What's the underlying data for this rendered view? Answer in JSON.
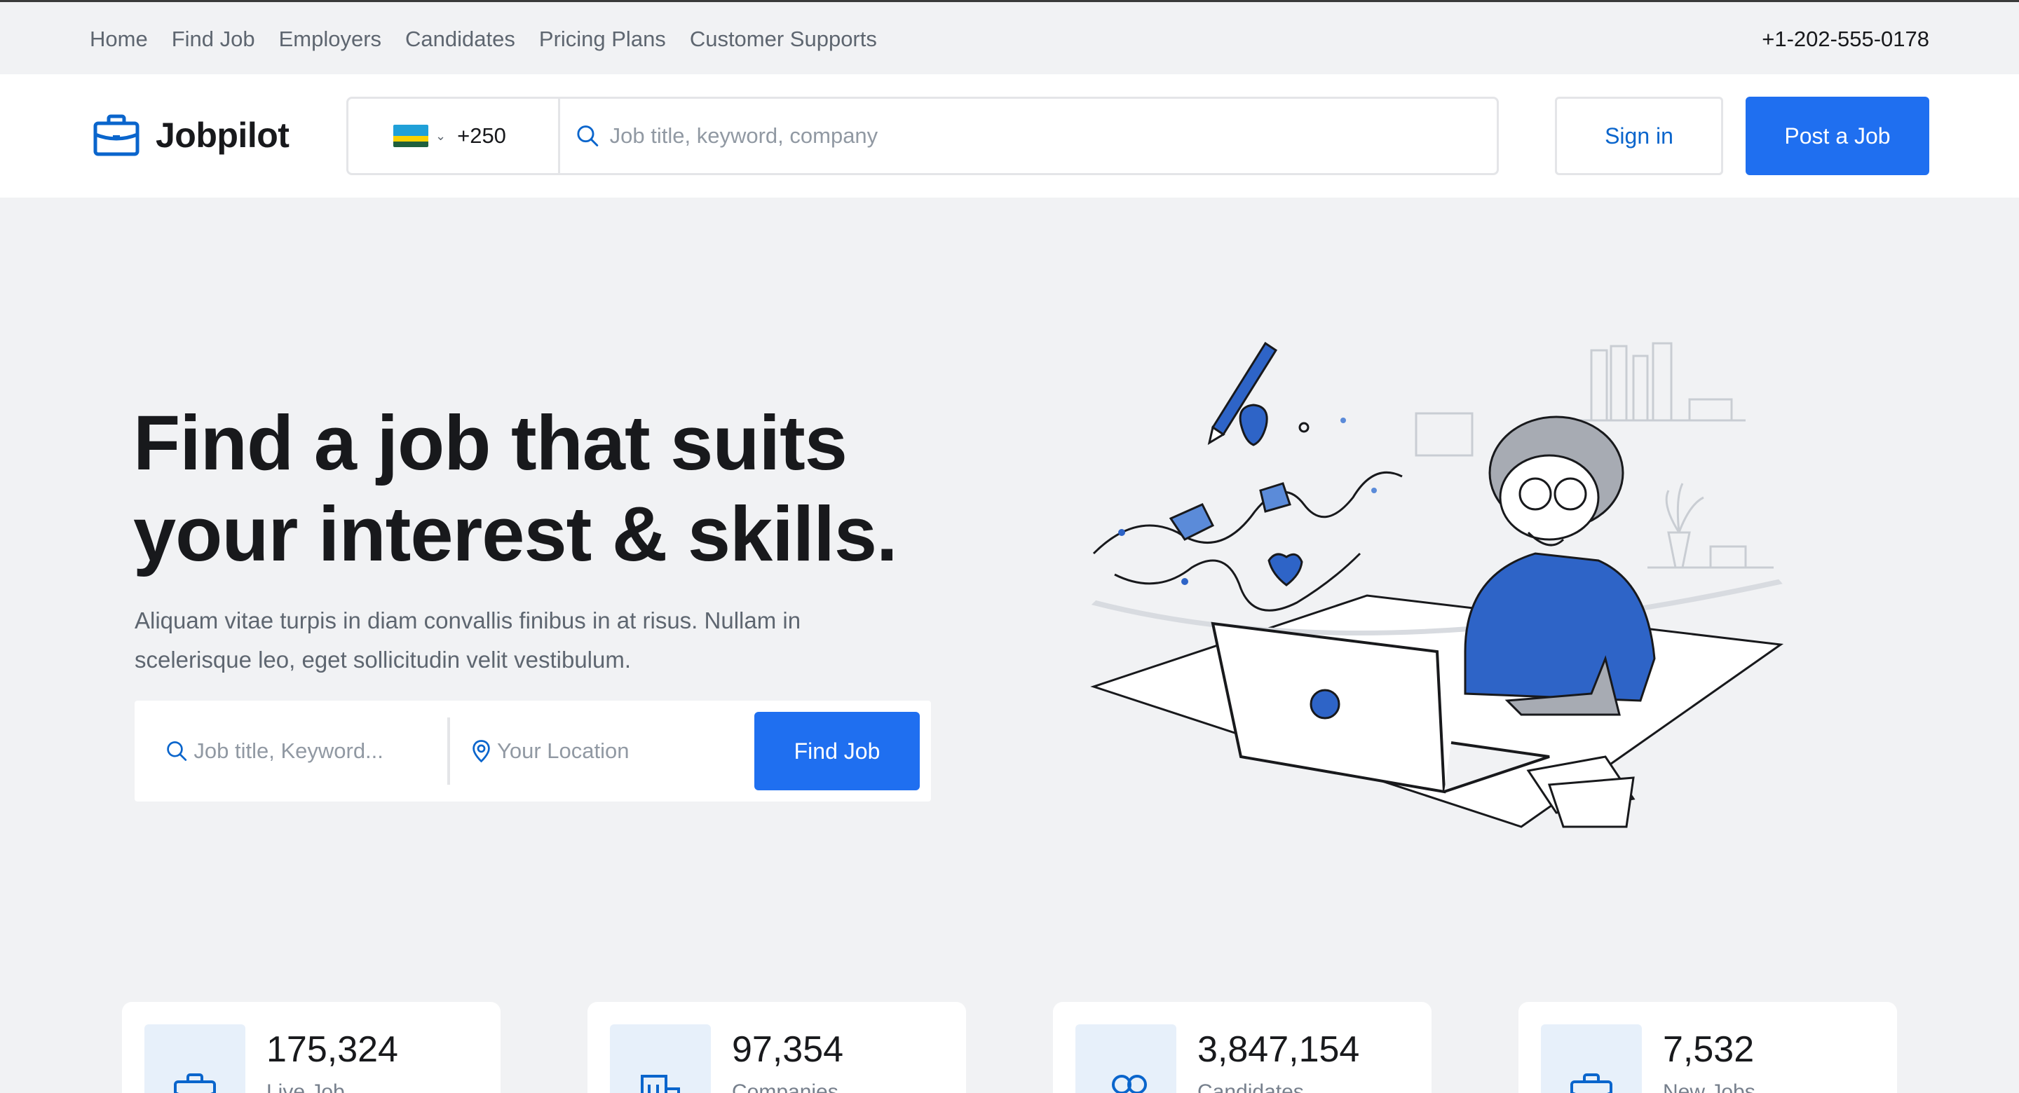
{
  "topnav": {
    "links": [
      "Home",
      "Find Job",
      "Employers",
      "Candidates",
      "Pricing Plans",
      "Customer Supports"
    ],
    "phone": "+1-202-555-0178"
  },
  "header": {
    "logo_text": "Jobpilot",
    "country_code": "+250",
    "flag_colors": [
      "#20A0D8",
      "#FAD201",
      "#20603D"
    ],
    "search_placeholder": "Job title, keyword, company",
    "signin_label": "Sign in",
    "post_label": "Post a Job"
  },
  "hero": {
    "title_line1": "Find a job that suits",
    "title_line2": "your interest & skills.",
    "description_line1": "Aliquam vitae turpis in diam convallis finibus in at risus. Nullam in",
    "description_line2": "scelerisque leo, eget sollicitudin velit vestibulum.",
    "keyword_placeholder": "Job title, Keyword...",
    "location_placeholder": "Your Location",
    "find_button": "Find Job"
  },
  "stats": [
    {
      "value": "175,324",
      "label": "Live Job",
      "icon": "briefcase-icon"
    },
    {
      "value": "97,354",
      "label": "Companies",
      "icon": "buildings-icon"
    },
    {
      "value": "3,847,154",
      "label": "Candidates",
      "icon": "users-icon"
    },
    {
      "value": "7,532",
      "label": "New Jobs",
      "icon": "briefcase-icon"
    }
  ],
  "colors": {
    "accent": "#1F6FF0",
    "brand_blue": "#0A65CC",
    "background": "#F1F2F4",
    "icon_bg": "#E7F0FA"
  }
}
